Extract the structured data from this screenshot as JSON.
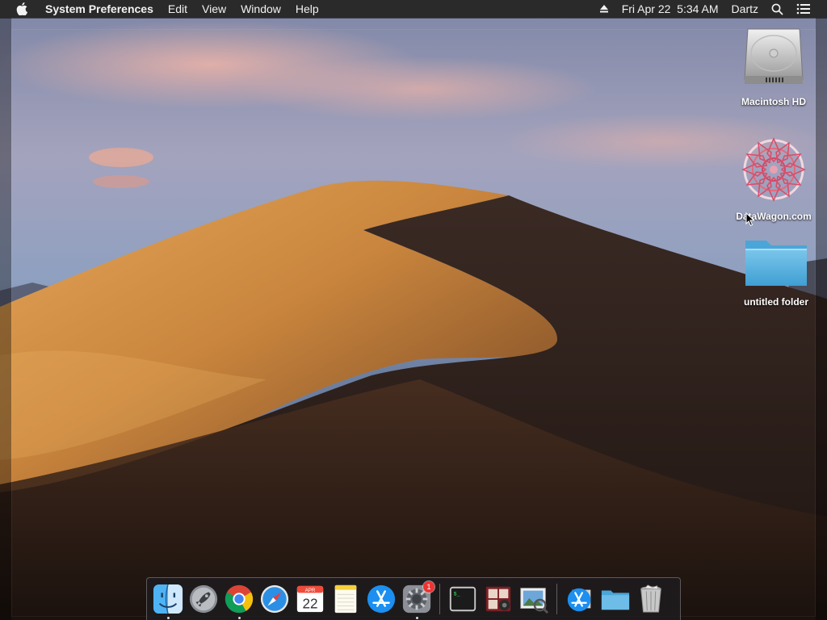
{
  "menubar": {
    "app_name": "System Preferences",
    "menus": [
      "Edit",
      "View",
      "Window",
      "Help"
    ],
    "datetime": "Fri Apr 22  5:34 AM",
    "user": "Dartz"
  },
  "desktop": {
    "icons": [
      {
        "label": "Macintosh HD",
        "icon": "hard-drive-icon"
      },
      {
        "label": "DataWagon.com",
        "icon": "mandala-disk-icon"
      },
      {
        "label": "untitled folder",
        "icon": "folder-icon"
      }
    ]
  },
  "dock": {
    "apps": [
      {
        "name": "Finder",
        "icon": "finder-icon",
        "running": true
      },
      {
        "name": "Launchpad",
        "icon": "launchpad-icon",
        "running": false
      },
      {
        "name": "Google Chrome",
        "icon": "chrome-icon",
        "running": true
      },
      {
        "name": "Safari",
        "icon": "safari-icon",
        "running": false
      },
      {
        "name": "Calendar",
        "icon": "calendar-icon",
        "running": false,
        "month": "APR",
        "day": "22"
      },
      {
        "name": "Notes",
        "icon": "notes-icon",
        "running": false
      },
      {
        "name": "App Store",
        "icon": "app-store-icon",
        "running": false
      },
      {
        "name": "System Preferences",
        "icon": "system-preferences-icon",
        "running": true,
        "badge": "1"
      },
      {
        "name": "Terminal",
        "icon": "terminal-icon",
        "running": false,
        "glyph": "$_"
      },
      {
        "name": "Photo Booth",
        "icon": "photo-booth-icon",
        "running": false
      },
      {
        "name": "Preview",
        "icon": "preview-icon",
        "running": false
      },
      {
        "name": "Applications",
        "icon": "applications-stack-icon",
        "running": false
      },
      {
        "name": "Downloads",
        "icon": "downloads-folder-icon",
        "running": false
      },
      {
        "name": "Trash",
        "icon": "trash-icon",
        "running": false
      }
    ]
  },
  "colors": {
    "menubar_bg": "#2b2a2b",
    "dune_light": "#d89a4e",
    "dune_shadow": "#2a1d18",
    "sky_top": "#8a93b3"
  }
}
